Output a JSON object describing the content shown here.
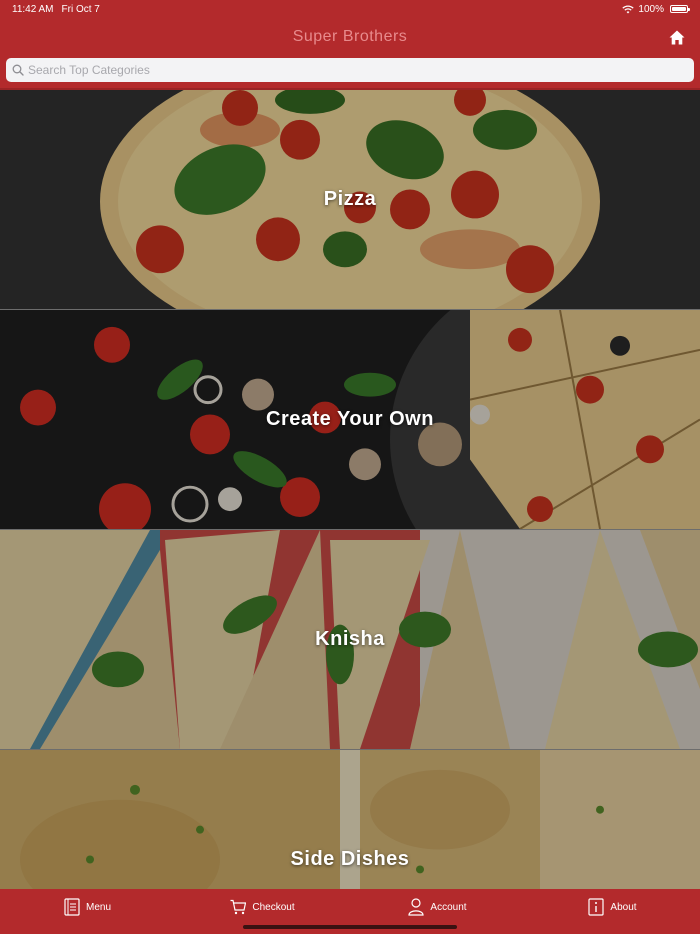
{
  "status_bar": {
    "time": "11:42 AM",
    "date": "Fri Oct 7",
    "battery": "100%",
    "icons": [
      "wifi-icon",
      "battery-icon"
    ]
  },
  "nav": {
    "title": "Super Brothers",
    "home_icon": "home-icon"
  },
  "search": {
    "placeholder": "Search Top Categories",
    "value": ""
  },
  "categories": [
    {
      "label": "Pizza"
    },
    {
      "label": "Create Your Own"
    },
    {
      "label": "Knisha"
    },
    {
      "label": "Side Dishes"
    }
  ],
  "tabs": [
    {
      "label": "Menu",
      "icon": "menu-book-icon"
    },
    {
      "label": "Checkout",
      "icon": "cart-icon"
    },
    {
      "label": "Account",
      "icon": "person-icon"
    },
    {
      "label": "About",
      "icon": "info-icon"
    }
  ],
  "colors": {
    "brand_red": "#b32a2c",
    "title_pink": "#e88a8c",
    "search_bg": "#f3f3f5"
  }
}
